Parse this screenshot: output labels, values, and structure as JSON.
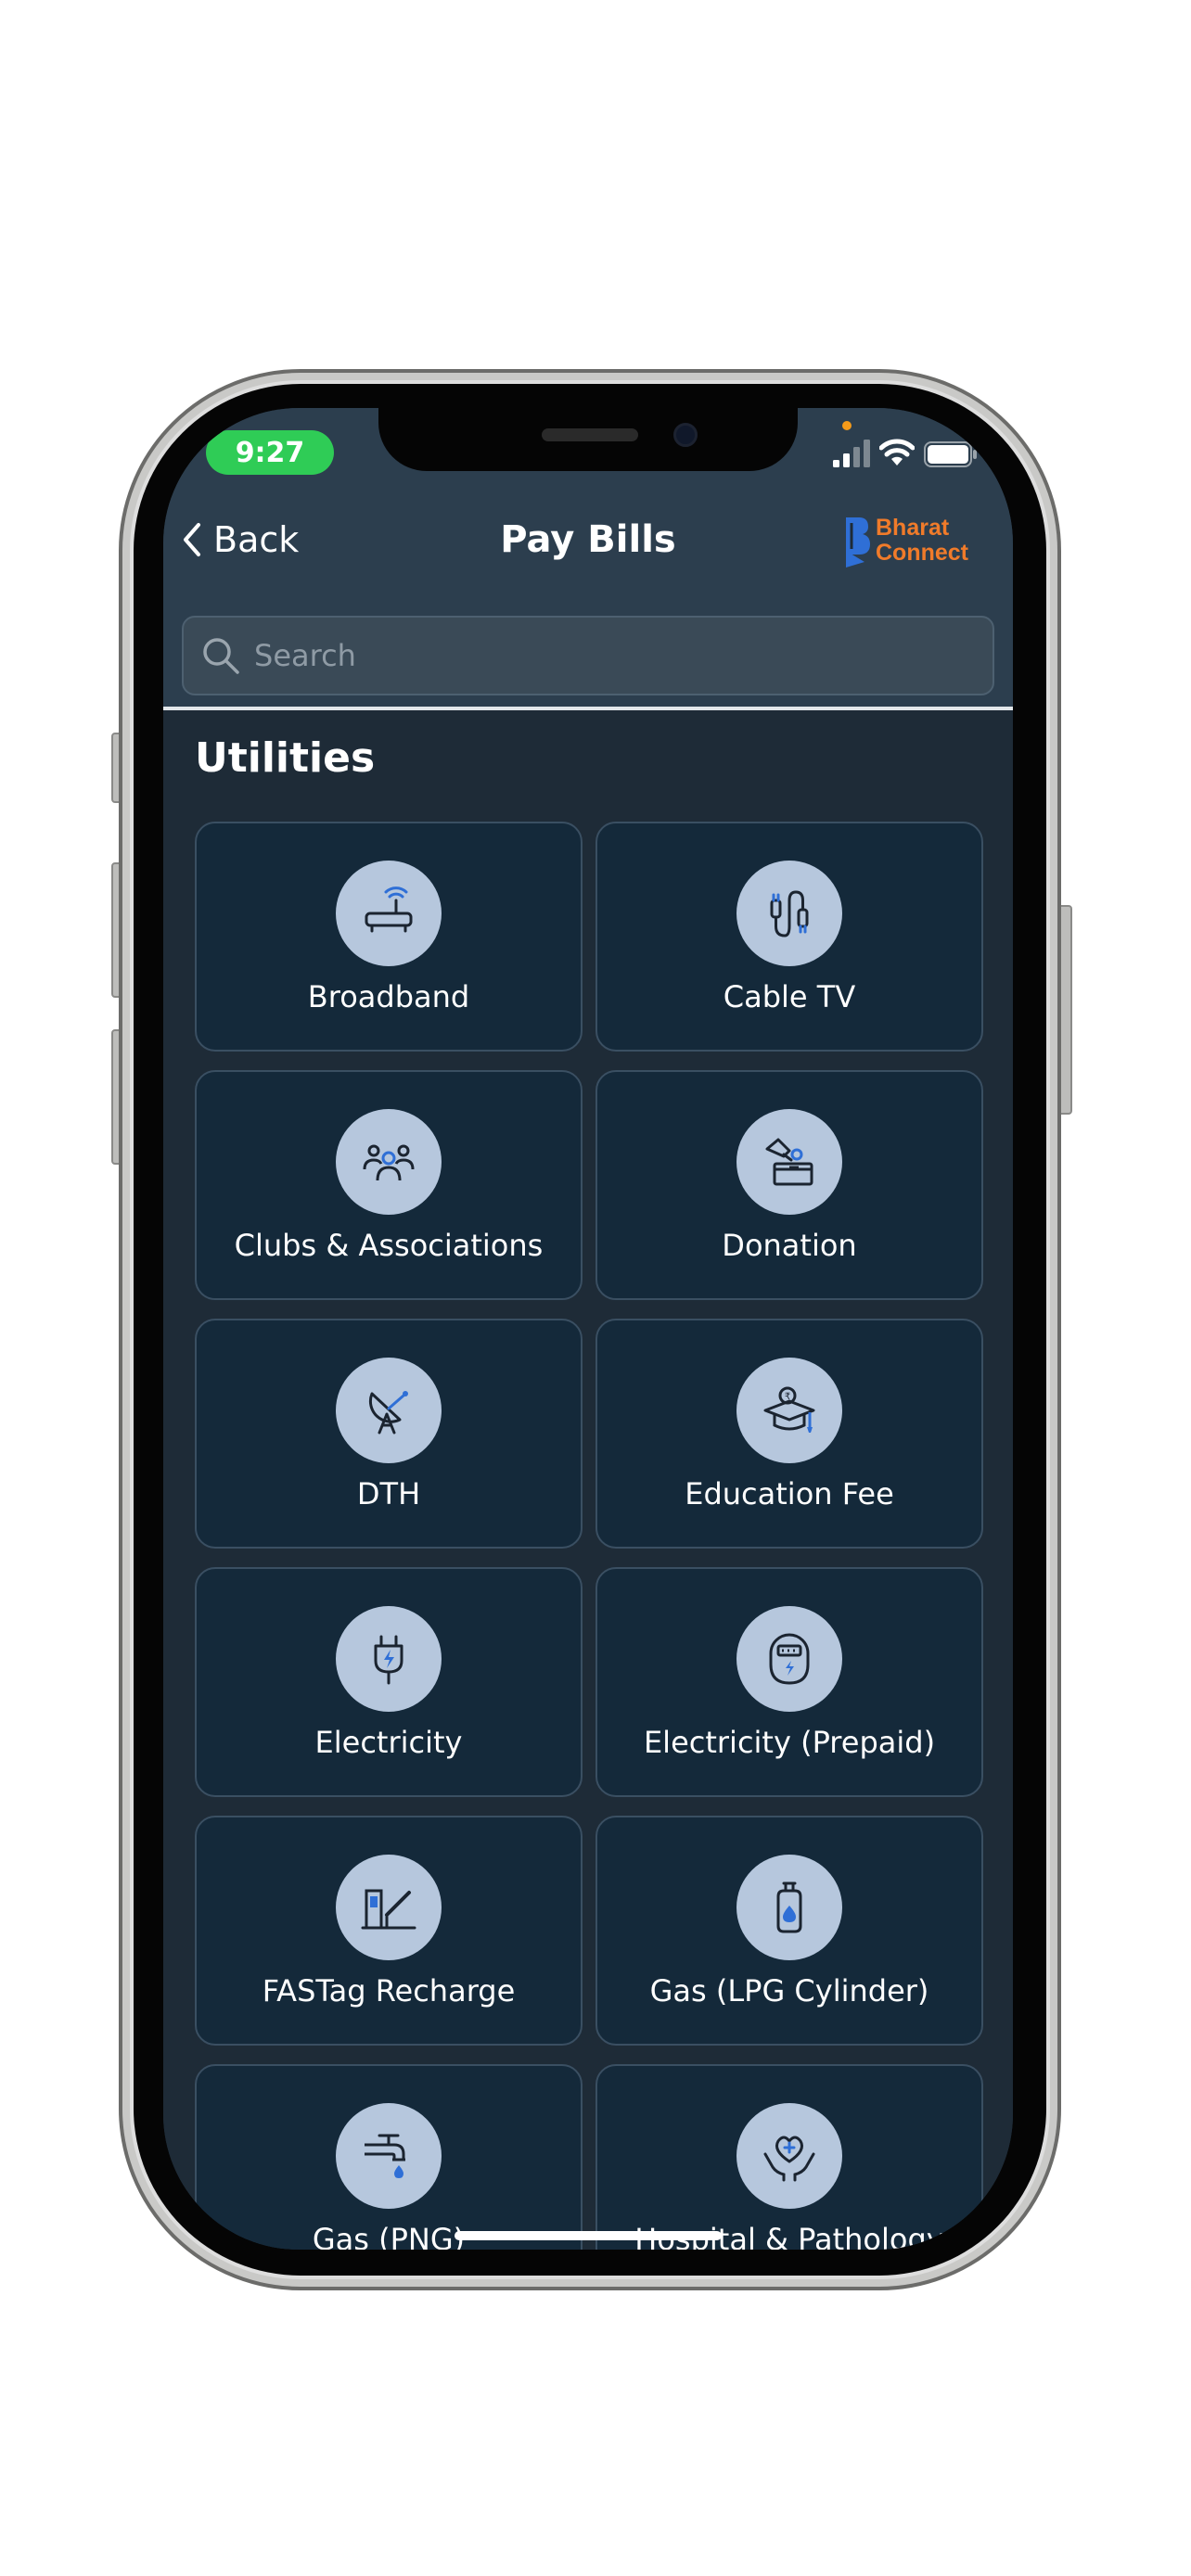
{
  "status_bar": {
    "time": "9:27"
  },
  "nav": {
    "back_label": "Back",
    "title": "Pay Bills",
    "brand_line1": "Bharat",
    "brand_line2": "Connect"
  },
  "search": {
    "placeholder": "Search"
  },
  "section": {
    "title": "Utilities"
  },
  "categories": [
    {
      "label": "Broadband",
      "icon": "router-icon"
    },
    {
      "label": "Cable TV",
      "icon": "cable-icon"
    },
    {
      "label": "Clubs & Associations",
      "icon": "people-icon"
    },
    {
      "label": "Donation",
      "icon": "donation-box-icon"
    },
    {
      "label": "DTH",
      "icon": "satellite-dish-icon"
    },
    {
      "label": "Education Fee",
      "icon": "graduation-cap-icon"
    },
    {
      "label": "Electricity",
      "icon": "plug-icon"
    },
    {
      "label": "Electricity (Prepaid)",
      "icon": "meter-icon"
    },
    {
      "label": "FASTag Recharge",
      "icon": "toll-gate-icon"
    },
    {
      "label": "Gas (LPG Cylinder)",
      "icon": "gas-cylinder-icon"
    },
    {
      "label": "Gas (PNG)",
      "icon": "gas-tap-icon"
    },
    {
      "label": "Hospital & Pathology",
      "icon": "health-care-icon"
    }
  ],
  "colors": {
    "header_bg": "#2c3e4e",
    "content_bg": "#1e2b37",
    "tile_bg": "#14293a",
    "icon_circle": "#b6c7dd",
    "icon_accent": "#2f6fd6",
    "time_pill": "#2fcc56",
    "brand_orange": "#f07b2a",
    "brand_blue": "#2f6fd6"
  }
}
